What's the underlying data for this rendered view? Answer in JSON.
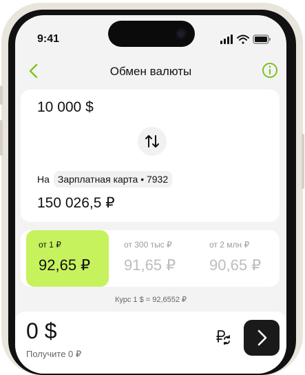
{
  "status_bar": {
    "time": "9:41"
  },
  "nav": {
    "title": "Обмен валюты"
  },
  "exchange": {
    "from_amount": "10 000 $",
    "to_prefix": "На",
    "to_account": "Зарплатная карта • 7932",
    "to_amount": "150 026,5 ₽"
  },
  "tiers": [
    {
      "label": "от 1 ₽",
      "value": "92,65 ₽"
    },
    {
      "label": "от 300 тыс ₽",
      "value": "91,65 ₽"
    },
    {
      "label": "от 2 млн ₽",
      "value": "90,65 ₽"
    }
  ],
  "rate_text": "Курс 1 $ = 92,6552 ₽",
  "bottom": {
    "amount": "0 $",
    "receive_text": "Получите 0 ₽"
  },
  "colors": {
    "accent_green": "#c6f25e",
    "icon_green": "#7fbf1f",
    "dark_button": "#1a1a1a"
  },
  "icons": [
    "back-chevron-icon",
    "info-icon",
    "swap-arrows-icon",
    "ruble-exchange-icon",
    "chevron-right-icon",
    "signal-icon",
    "wifi-icon",
    "battery-icon"
  ]
}
